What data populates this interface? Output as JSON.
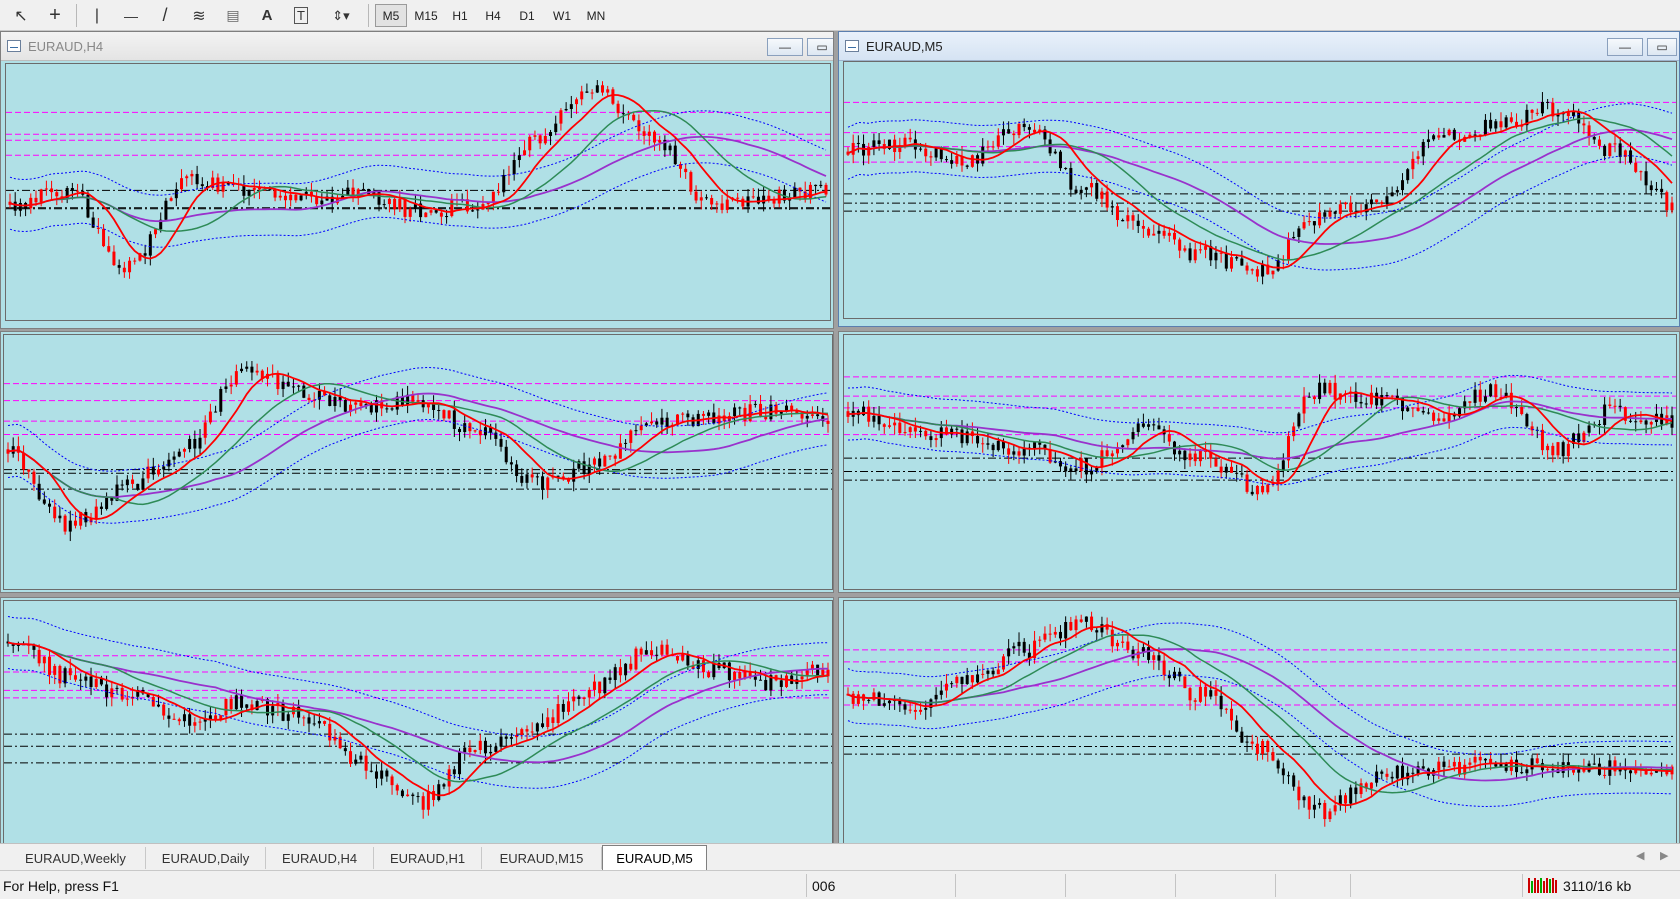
{
  "toolbar": {
    "tools": [
      {
        "name": "cursor-tool",
        "glyph": "↖"
      },
      {
        "name": "crosshair-tool",
        "glyph": "+"
      },
      {
        "name": "vertical-line-tool",
        "glyph": "|"
      },
      {
        "name": "horizontal-line-tool",
        "glyph": "—"
      },
      {
        "name": "trendline-tool",
        "glyph": "/"
      },
      {
        "name": "fibonacci-tool",
        "glyph": "≋"
      },
      {
        "name": "fibo-fan-tool",
        "glyph": "▤"
      },
      {
        "name": "text-tool",
        "glyph": "A"
      },
      {
        "name": "text-label-tool",
        "glyph": "T"
      },
      {
        "name": "arrows-tool",
        "glyph": "⇕▾"
      }
    ],
    "timeframes": [
      "M5",
      "M15",
      "H1",
      "H4",
      "D1",
      "W1",
      "MN"
    ],
    "active_timeframe": "M5"
  },
  "windows": {
    "h4_title": "EURAUD,H4",
    "m5_title": "EURAUD,M5",
    "minimize_glyph": "—"
  },
  "tabs": [
    "EURAUD,Weekly",
    "EURAUD,Daily",
    "EURAUD,H4",
    "EURAUD,H1",
    "EURAUD,M15",
    "EURAUD,M5"
  ],
  "active_tab": "EURAUD,M5",
  "status": {
    "help": "For Help, press F1",
    "profile": "006",
    "traffic": "3110/16 kb"
  },
  "colors": {
    "chart_bg": "#b0e0e6",
    "candle": "#000000",
    "candle_alt": "#ff0000",
    "ma_fast": "#ff0000",
    "ma_mid": "#2e8b57",
    "ma_slow": "#9932cc",
    "bands": "#0000ff",
    "level_magenta": "#ff00ff",
    "level_black": "#000000"
  }
}
